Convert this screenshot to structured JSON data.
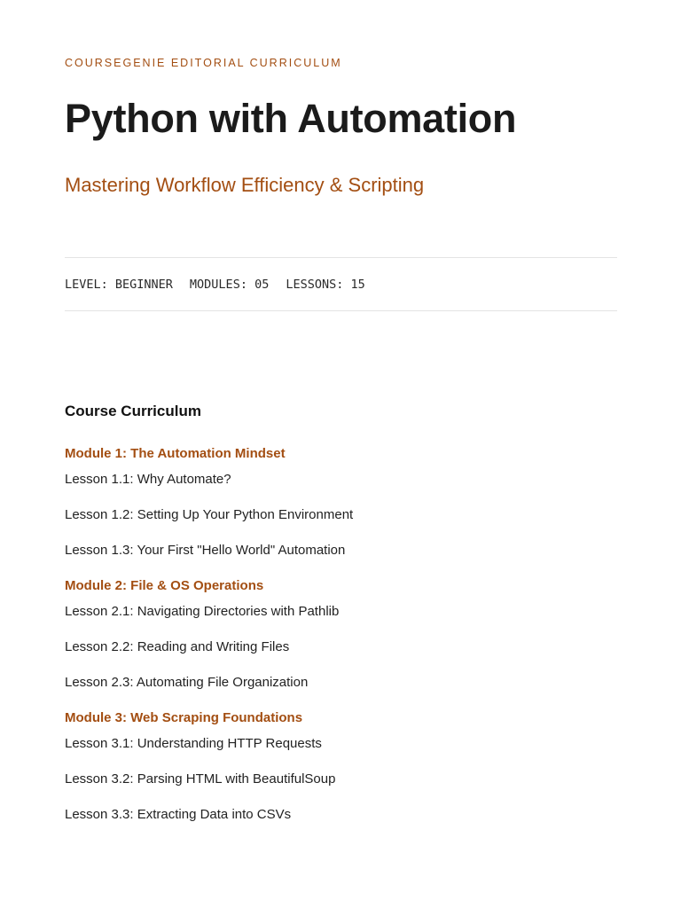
{
  "header": {
    "eyebrow": "COURSEGENIE EDITORIAL CURRICULUM",
    "title": "Python with Automation",
    "subtitle": "Mastering Workflow Efficiency & Scripting"
  },
  "meta": {
    "level": "LEVEL: BEGINNER",
    "modules": "MODULES: 05",
    "lessons": "LESSONS: 15"
  },
  "curriculum": {
    "heading": "Course Curriculum",
    "modules": [
      {
        "title": "Module 1: The Automation Mindset",
        "lessons": [
          "Lesson 1.1: Why Automate?",
          "Lesson 1.2: Setting Up Your Python Environment",
          "Lesson 1.3: Your First \"Hello World\" Automation"
        ]
      },
      {
        "title": "Module 2: File & OS Operations",
        "lessons": [
          "Lesson 2.1: Navigating Directories with Pathlib",
          "Lesson 2.2: Reading and Writing Files",
          "Lesson 2.3: Automating File Organization"
        ]
      },
      {
        "title": "Module 3: Web Scraping Foundations",
        "lessons": [
          "Lesson 3.1: Understanding HTTP Requests",
          "Lesson 3.2: Parsing HTML with BeautifulSoup",
          "Lesson 3.3: Extracting Data into CSVs"
        ]
      }
    ]
  },
  "colors": {
    "accent": "#a34e12",
    "text": "#1a1a1a",
    "divider": "#e4e4e4"
  }
}
